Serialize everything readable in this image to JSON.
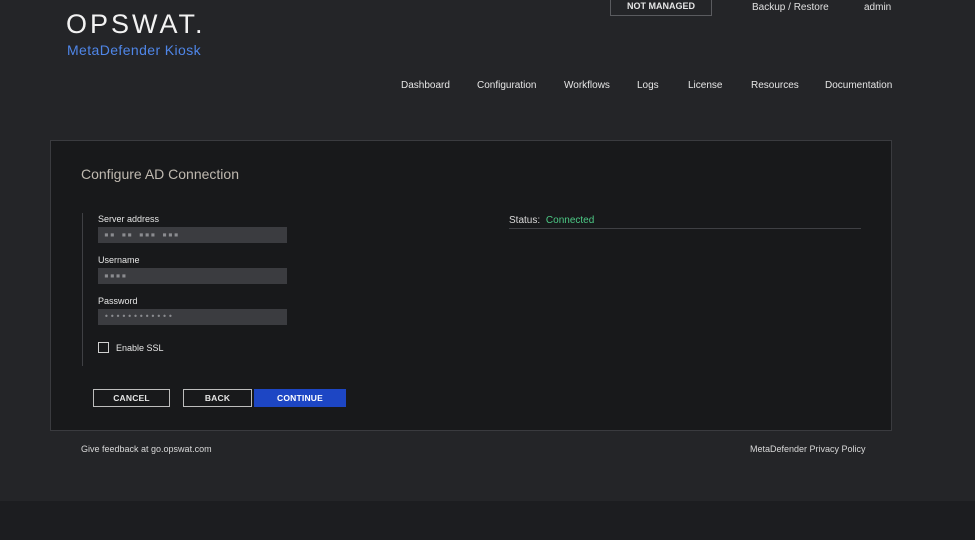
{
  "brand": {
    "logo": "OPSWAT.",
    "product": "MetaDefender Kiosk"
  },
  "top_bar": {
    "not_managed": "NOT MANAGED",
    "backup_restore": "Backup / Restore",
    "user": "admin"
  },
  "nav": {
    "items": [
      {
        "label": "Dashboard"
      },
      {
        "label": "Configuration"
      },
      {
        "label": "Workflows"
      },
      {
        "label": "Logs"
      },
      {
        "label": "License"
      },
      {
        "label": "Resources"
      },
      {
        "label": "Documentation"
      }
    ]
  },
  "panel": {
    "title": "Configure AD Connection",
    "server_address": {
      "label": "Server address",
      "value": "▪▪ ▪▪ ▪▪▪ ▪▪▪"
    },
    "username": {
      "label": "Username",
      "value": "▪▪▪▪"
    },
    "password": {
      "label": "Password",
      "value": "••••••••••••"
    },
    "enable_ssl": {
      "label": "Enable SSL",
      "checked": false
    },
    "status": {
      "label": "Status:",
      "value": "Connected",
      "color": "#4cc985"
    },
    "buttons": {
      "cancel": "CANCEL",
      "back": "BACK",
      "continue": "CONTINUE"
    }
  },
  "footer": {
    "feedback": "Give feedback at go.opswat.com",
    "privacy": "MetaDefender Privacy Policy"
  },
  "colors": {
    "accent": "#1d46c4",
    "brand_blue": "#4f86e8",
    "background": "#242528",
    "panel": "#18191b"
  }
}
